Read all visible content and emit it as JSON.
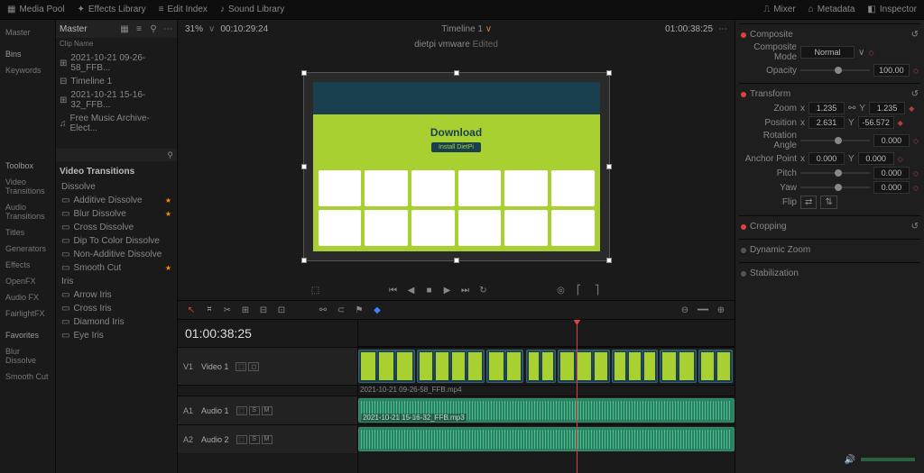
{
  "toptabs": {
    "mediapool": "Media Pool",
    "fx": "Effects Library",
    "editidx": "Edit Index",
    "sound": "Sound Library",
    "mixer": "Mixer",
    "metadata": "Metadata",
    "inspector": "Inspector"
  },
  "header": {
    "master": "Master",
    "pct": "31%",
    "tc_left": "00:10:29:24",
    "title": "dietpi vmware",
    "status": "Edited",
    "timeline": "Timeline 1",
    "tc_right": "01:00:38:25"
  },
  "pool": {
    "hdr": "Clip Name",
    "rows": [
      "2021-10-21 09-26-58_FFB...",
      "Timeline 1",
      "2021-10-21 15-16-32_FFB...",
      "Free Music Archive- Elect..."
    ]
  },
  "leftnav": {
    "a": "Master",
    "bins": "Bins",
    "kw": "Keywords",
    "tb": "Toolbox",
    "vt": "Video Transitions",
    "at": "Audio Transitions",
    "titles": "Titles",
    "gen": "Generators",
    "eff": "Effects",
    "ofx": "OpenFX",
    "aufx": "Audio FX",
    "fl": "FairlightFX",
    "fav": "Favorites",
    "bd": "Blur Dissolve",
    "sc": "Smooth Cut"
  },
  "fx": {
    "hdr": "Video Transitions",
    "sub": "Dissolve",
    "items": [
      "Additive Dissolve",
      "Blur Dissolve",
      "Cross Dissolve",
      "Dip To Color Dissolve",
      "Non-Additive Dissolve",
      "Smooth Cut"
    ],
    "sub2": "Iris",
    "items2": [
      "Arrow Iris",
      "Cross Iris",
      "Diamond Iris",
      "Eye Iris"
    ]
  },
  "preview": {
    "title": "Download",
    "btn": "Install DietPi"
  },
  "toolbar": {
    "tc": "01:00:38:25"
  },
  "tracks": {
    "v1": "V1",
    "v1n": "Video 1",
    "a1": "A1",
    "a1n": "Audio 1",
    "a2": "A2",
    "a2n": "Audio 2",
    "clip_v": "2021-10-21 09-26-58_FFB.mp4",
    "clip_a": "2021-10-21 15-16-32_FFB.mp3",
    "btn_lock": "⬚",
    "btn_s": "S",
    "btn_m": "M"
  },
  "insp": {
    "composite": "Composite",
    "comp_mode_lbl": "Composite Mode",
    "comp_mode": "Normal",
    "opacity_lbl": "Opacity",
    "opacity": "100.00",
    "transform": "Transform",
    "zoom_lbl": "Zoom",
    "zoom_x": "1.235",
    "zoom_y": "1.235",
    "pos_lbl": "Position",
    "pos_x": "2.631",
    "pos_y": "-56.572",
    "rot_lbl": "Rotation Angle",
    "rot": "0.000",
    "anch_lbl": "Anchor Point",
    "anch_x": "0.000",
    "anch_y": "0.000",
    "pitch_lbl": "Pitch",
    "pitch": "0.000",
    "yaw_lbl": "Yaw",
    "yaw": "0.000",
    "flip_lbl": "Flip",
    "cropping": "Cropping",
    "dz": "Dynamic Zoom",
    "stab": "Stabilization"
  }
}
